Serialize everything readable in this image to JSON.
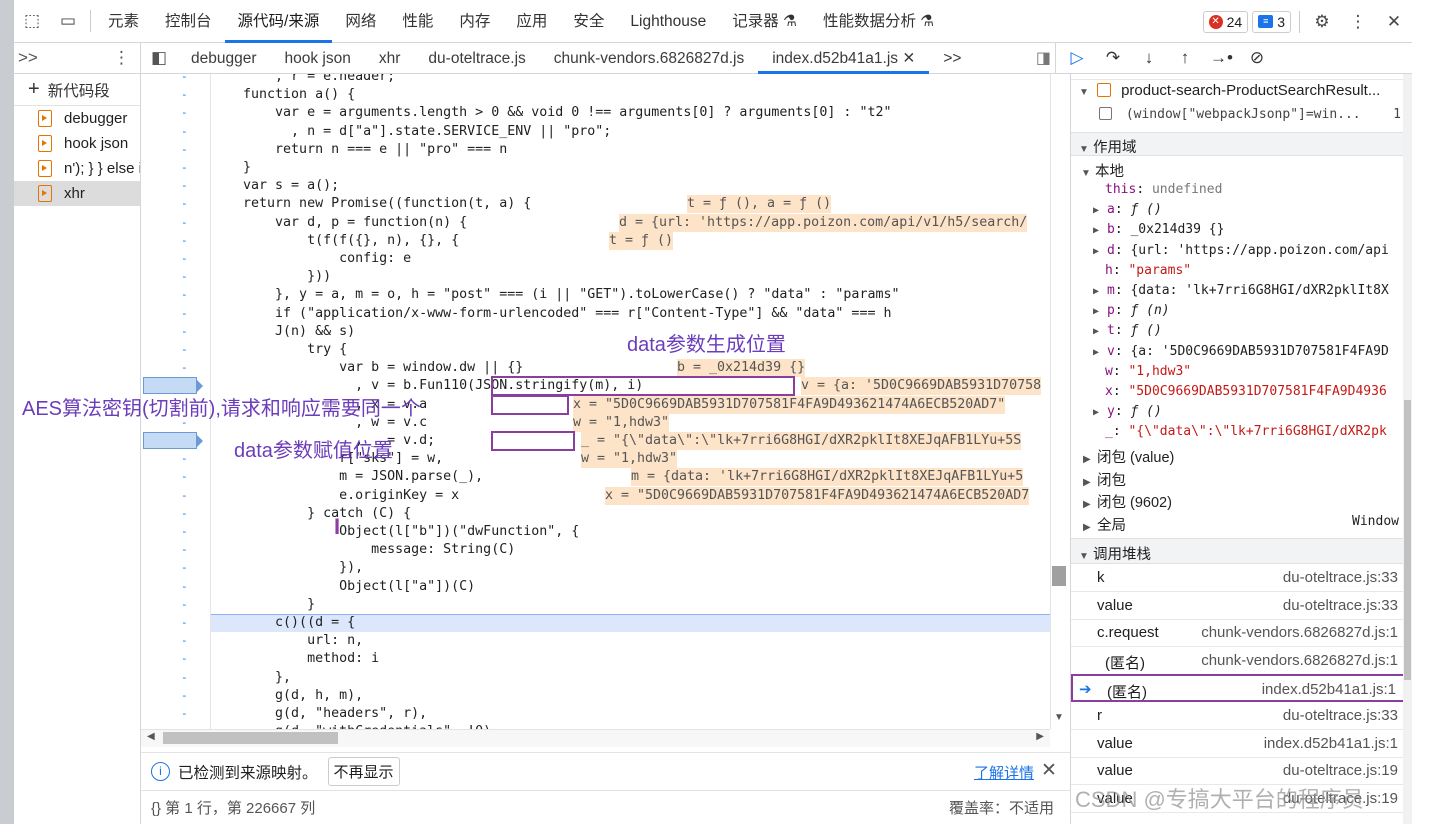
{
  "topbar": {
    "tabs": [
      "元素",
      "控制台",
      "源代码/来源",
      "网络",
      "性能",
      "内存",
      "应用",
      "安全",
      "Lighthouse",
      "记录器 ⚗",
      "性能数据分析 ⚗"
    ],
    "active_tab": "源代码/来源",
    "error_count": "24",
    "message_count": "3"
  },
  "navigator": {
    "more": ">>",
    "new_snippet": "新代码段",
    "snippets": [
      "debugger",
      "hook json",
      "n'); } } else i",
      "xhr"
    ],
    "selected": "xhr"
  },
  "file_tabs": [
    "debugger",
    "hook json",
    "xhr",
    "du-oteltrace.js",
    "chunk-vendors.6826827d.js",
    "index.d52b41a1.js"
  ],
  "active_file": "index.d52b41a1.js",
  "code_lines": [
    "        , r = e.header;",
    "    function a() {",
    "        var e = arguments.length > 0 && void 0 !== arguments[0] ? arguments[0] : \"t2\"",
    "          , n = d[\"a\"].state.SERVICE_ENV || \"pro\";",
    "        return n === e || \"pro\" === n",
    "    }",
    "    var s = a();",
    "    return new Promise((function(t, a) {",
    "        var d, p = function(n) {",
    "            t(f(f({}, n), {}, {",
    "                config: e",
    "            }))",
    "        }, y = a, m = o, h = \"post\" === (i || \"GET\").toLowerCase() ? \"data\" : \"params\"",
    "        if (\"application/x-www-form-urlencoded\" === r[\"Content-Type\"] && \"data\" === h",
    "        J(n) && s)",
    "            try {",
    "                var b = window.dw || {}",
    "                  , v = b.Fun110(JSON.stringify(m), i)",
    "                  , x = v.a",
    "                  , w = v.c",
    "                  , _ = v.d;",
    "                r[\"sks\"] = w,",
    "                m = JSON.parse(_),",
    "                e.originKey = x",
    "            } catch (C) {",
    "                Object(l[\"b\"])(\"dwFunction\", {",
    "                    message: String(C)",
    "                }),",
    "                Object(l[\"a\"])(C)",
    "            }",
    "        c()((d = {",
    "            url: n,",
    "            method: i",
    "        },",
    "        g(d, h, m),",
    "        g(d, \"headers\", r),",
    "        g(d, \"withCredentials\", !0),"
  ],
  "inline_values": {
    "t_a": "t = ƒ (), a = ƒ ()",
    "d_url": "d = {url: 'https://app.poizon.com/api/v1/h5/search/",
    "t_f": "t = ƒ ()",
    "b": "b = _0x214d39 {}",
    "v": "v = {a: '5D0C9669DAB5931D70758",
    "x": "x = \"5D0C9669DAB5931D707581F4FA9D493621474A6ECB520AD7\"",
    "w": "w = \"1,hdw3\"",
    "underscore": "_ = \"{\\\"data\\\":\\\"lk+7rri6G8HGI/dXR2pklIt8XEJqAFB1LYu+5S",
    "w2": "w = \"1,hdw3\"",
    "m": "m = {data: 'lk+7rri6G8HGI/dXR2pklIt8XEJqAFB1LYu+5",
    "x2": "x = \"5D0C9669DAB5931D707581F4FA9D493621474A6ECB520AD7"
  },
  "annotations": {
    "data_gen": "data参数生成位置",
    "aes_key": "AES算法密钥(切割前),请求和响应需要同一个",
    "data_assign": "data参数赋值位置"
  },
  "infobar": {
    "text": "已检测到来源映射。",
    "dismiss": "不再显示",
    "learn_more": "了解详情"
  },
  "statusbar": {
    "position": "{} 第 1 行，第 226667 列",
    "coverage": "覆盖率：不适用"
  },
  "right_panel": {
    "breakpoint_file": "product-search-ProductSearchResult...",
    "breakpoint_code": "(window[\"webpackJsonp\"]=win...",
    "breakpoint_line": "1",
    "scope_title": "作用域",
    "local_title": "本地",
    "scope_vars": [
      {
        "name": "this",
        "value": "undefined",
        "expandable": false
      },
      {
        "name": "a",
        "value": "ƒ ()",
        "expandable": true
      },
      {
        "name": "b",
        "value": "_0x214d39 {}",
        "expandable": true
      },
      {
        "name": "d",
        "value": "{url: 'https://app.poizon.com/api",
        "expandable": true
      },
      {
        "name": "h",
        "value": "\"params\"",
        "expandable": false
      },
      {
        "name": "m",
        "value": "{data: 'lk+7rri6G8HGI/dXR2pklIt8X",
        "expandable": true
      },
      {
        "name": "p",
        "value": "ƒ (n)",
        "expandable": true
      },
      {
        "name": "t",
        "value": "ƒ ()",
        "expandable": true
      },
      {
        "name": "v",
        "value": "{a: '5D0C9669DAB5931D707581F4FA9D",
        "expandable": true
      },
      {
        "name": "w",
        "value": "\"1,hdw3\"",
        "expandable": false
      },
      {
        "name": "x",
        "value": "\"5D0C9669DAB5931D707581F4FA9D4936",
        "expandable": false
      },
      {
        "name": "y",
        "value": "ƒ ()",
        "expandable": true
      },
      {
        "name": "_",
        "value": "\"{\\\"data\\\":\\\"lk+7rri6G8HGI/dXR2pk",
        "expandable": false
      }
    ],
    "closures": [
      "闭包 (value)",
      "闭包",
      "闭包 (9602)",
      "全局"
    ],
    "global_value": "Window",
    "callstack_title": "调用堆栈",
    "callstack": [
      {
        "fn": "k",
        "loc": "du-oteltrace.js:33"
      },
      {
        "fn": "value",
        "loc": "du-oteltrace.js:33"
      },
      {
        "fn": "c.request",
        "loc": "chunk-vendors.6826827d.js:1"
      },
      {
        "fn": "(匿名)",
        "loc": "chunk-vendors.6826827d.js:1"
      },
      {
        "fn": "(匿名)",
        "loc": "index.d52b41a1.js:1"
      },
      {
        "fn": "r",
        "loc": "du-oteltrace.js:33"
      },
      {
        "fn": "value",
        "loc": "index.d52b41a1.js:1"
      },
      {
        "fn": "value",
        "loc": "du-oteltrace.js:19"
      },
      {
        "fn": "value",
        "loc": "du-oteltrace.js:19"
      }
    ],
    "current_frame": 4
  },
  "watermark": "CSDN @专搞大平台的程序员"
}
